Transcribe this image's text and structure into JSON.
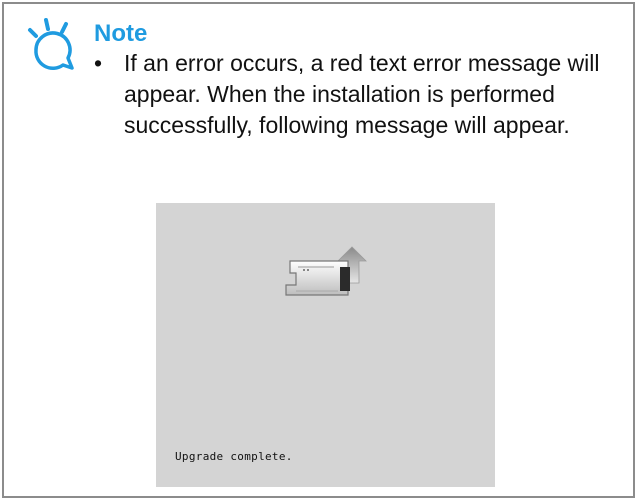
{
  "note": {
    "title": "Note",
    "bullet": "•",
    "text": "If an error occurs, a red text error message will appear. When the installation is performed successfully, following message will appear.",
    "icon": "lightbulb-icon",
    "title_color": "#1f9be0"
  },
  "screen": {
    "status_message": "Upgrade complete.",
    "icon": "sewing-machine-upgrade-icon",
    "background": "#d4d4d4"
  }
}
